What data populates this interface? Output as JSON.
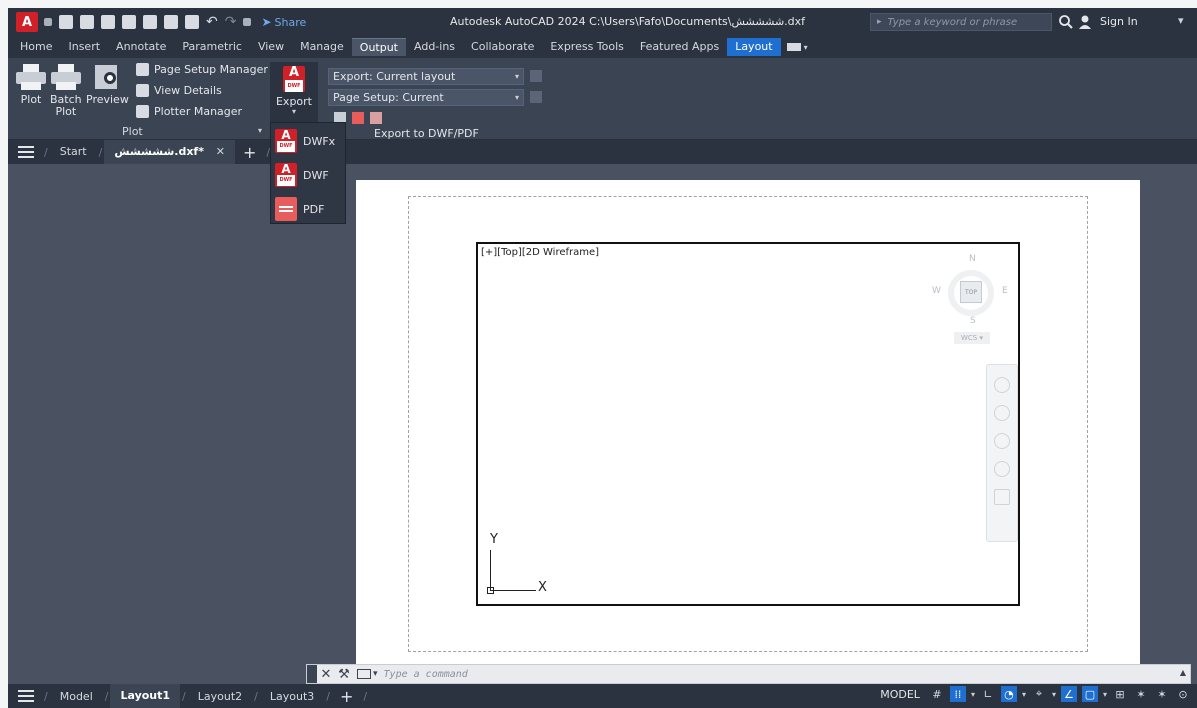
{
  "titlebar": {
    "logo": "A",
    "share": "Share",
    "title": "Autodesk AutoCAD 2024   C:\\Users\\Fafo\\Documents\\ششششش.dxf",
    "search_placeholder": "Type a keyword or phrase",
    "sign_in": "Sign In"
  },
  "ribbon_tabs": [
    "Home",
    "Insert",
    "Annotate",
    "Parametric",
    "View",
    "Manage",
    "Output",
    "Add-ins",
    "Collaborate",
    "Express Tools",
    "Featured Apps",
    "Layout"
  ],
  "ribbon": {
    "plot": "Plot",
    "batch_plot_1": "Batch",
    "batch_plot_2": "Plot",
    "preview": "Preview",
    "page_setup_manager": "Page Setup Manager",
    "view_details": "View Details",
    "plotter_manager": "Plotter Manager",
    "panel_plot": "Plot",
    "export": "Export",
    "export_combo": "Export: Current layout",
    "page_setup_combo": "Page Setup: Current",
    "tooltip": "Export to DWF/PDF"
  },
  "flyout": {
    "dwfx": "DWFx",
    "dwf": "DWF",
    "pdf": "PDF",
    "dwf_logo": "A",
    "dwf_badge": "DWF"
  },
  "file_tabs": {
    "start": "Start",
    "active": "ششششش.dxf*"
  },
  "viewport": {
    "label": "[+][Top][2D Wireframe]",
    "n": "N",
    "s": "S",
    "e": "E",
    "w": "W",
    "top": "TOP",
    "wcs": "WCS ▾",
    "y": "Y",
    "x": "X"
  },
  "cmdline": {
    "placeholder": "Type a command"
  },
  "status": {
    "tabs": [
      "Model",
      "Layout1",
      "Layout2",
      "Layout3"
    ],
    "active_tab": "Layout1",
    "model": "MODEL"
  },
  "colors": {
    "accent": "#1f6fd0",
    "brand_red": "#d02028",
    "dark_bg": "#2b3341",
    "panel_bg": "#3b4453"
  }
}
